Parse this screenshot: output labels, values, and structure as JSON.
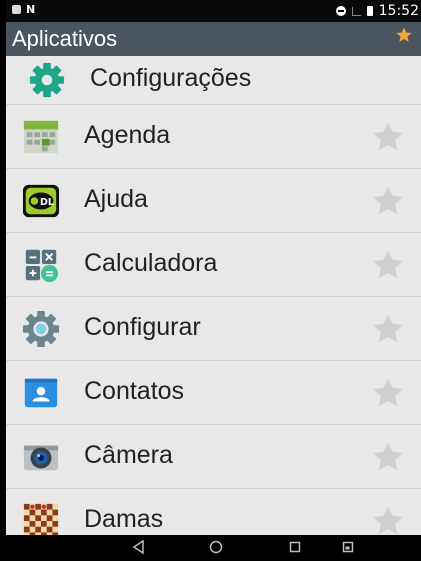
{
  "status_bar": {
    "time": "15:52"
  },
  "header": {
    "title": "Aplicativos"
  },
  "apps": [
    {
      "label": "Configurações",
      "icon": "gear-icon"
    },
    {
      "label": "Agenda",
      "icon": "calendar-icon"
    },
    {
      "label": "Ajuda",
      "icon": "help-icon"
    },
    {
      "label": "Calculadora",
      "icon": "calculator-icon"
    },
    {
      "label": "Configurar",
      "icon": "settings-cog-icon"
    },
    {
      "label": "Contatos",
      "icon": "contacts-icon"
    },
    {
      "label": "Câmera",
      "icon": "camera-icon"
    },
    {
      "label": "Damas",
      "icon": "checkers-icon"
    }
  ],
  "colors": {
    "titlebar": "#4a5560",
    "background": "#e8e8e8",
    "favorite_star": "#f2a73b",
    "inactive_star": "#cfcfcf"
  }
}
